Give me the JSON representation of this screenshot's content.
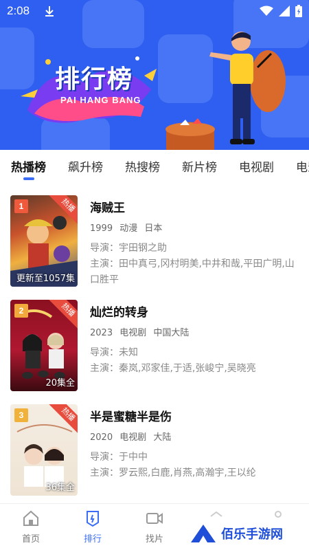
{
  "status_bar": {
    "time": "2:08"
  },
  "banner": {
    "title": "排行榜",
    "subtitle": "PAI HANG BANG"
  },
  "tabs": [
    {
      "label": "热播榜",
      "active": true
    },
    {
      "label": "飙升榜",
      "active": false
    },
    {
      "label": "热搜榜",
      "active": false
    },
    {
      "label": "新片榜",
      "active": false
    },
    {
      "label": "电视剧",
      "active": false
    },
    {
      "label": "电影",
      "active": false
    }
  ],
  "items": [
    {
      "rank": "1",
      "badge": "热播",
      "episodes": "更新至1057集",
      "title": "海贼王",
      "year": "1999",
      "genre": "动漫",
      "region": "日本",
      "director": "导演：宇田钢之助",
      "cast": "主演：田中真弓,冈村明美,中井和哉,平田广明,山口胜平"
    },
    {
      "rank": "2",
      "badge": "热播",
      "episodes": "20集全",
      "title": "灿烂的转身",
      "year": "2023",
      "genre": "电视剧",
      "region": "中国大陆",
      "director": "导演：未知",
      "cast": "主演：秦岚,邓家佳,于适,张峻宁,吴晓亮"
    },
    {
      "rank": "3",
      "badge": "热播",
      "episodes": "36集全",
      "title": "半是蜜糖半是伤",
      "year": "2020",
      "genre": "电视剧",
      "region": "大陆",
      "director": "导演：于中中",
      "cast": "主演：罗云熙,白鹿,肖燕,高瀚宇,王以纶"
    }
  ],
  "nav": [
    {
      "label": "首页",
      "icon": "home-icon",
      "active": false
    },
    {
      "label": "排行",
      "icon": "ranking-icon",
      "active": true
    },
    {
      "label": "找片",
      "icon": "video-camera-icon",
      "active": false
    },
    {
      "label": "",
      "icon": "gift-icon",
      "active": false
    },
    {
      "label": "",
      "icon": "user-icon",
      "active": false
    }
  ],
  "watermark": {
    "text": "佰乐手游网"
  },
  "colors": {
    "banner": "#2f5ff0",
    "accent": "#3b6cf6",
    "rank": "#f05a3c",
    "ribbon": "#e84c3d"
  }
}
